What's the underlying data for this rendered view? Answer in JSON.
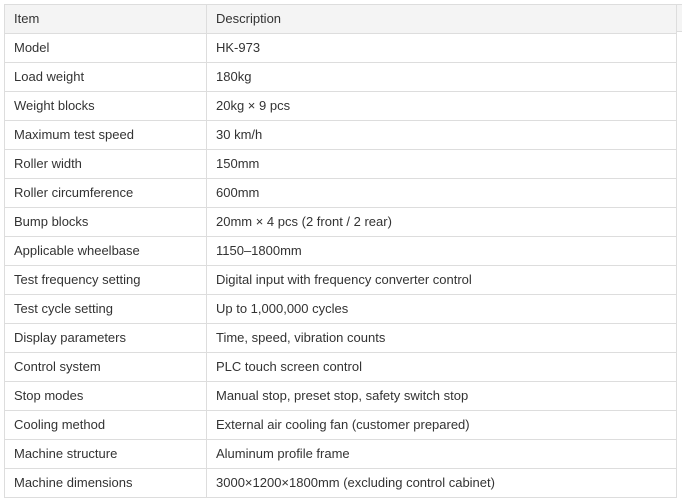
{
  "table": {
    "headers": [
      "Item",
      "Description"
    ],
    "rows": [
      [
        "Model",
        "HK-973"
      ],
      [
        "Load weight",
        "180kg"
      ],
      [
        "Weight blocks",
        "20kg × 9 pcs"
      ],
      [
        "Maximum test speed",
        "30 km/h"
      ],
      [
        "Roller width",
        "150mm"
      ],
      [
        "Roller circumference",
        "600mm"
      ],
      [
        "Bump blocks",
        "20mm × 4 pcs (2 front / 2 rear)"
      ],
      [
        "Applicable wheelbase",
        "1150–1800mm"
      ],
      [
        "Test frequency setting",
        "Digital input with frequency converter control"
      ],
      [
        "Test cycle setting",
        "Up to 1,000,000 cycles"
      ],
      [
        "Display parameters",
        "Time, speed, vibration counts"
      ],
      [
        "Control system",
        "PLC touch screen control"
      ],
      [
        "Stop modes",
        "Manual stop, preset stop, safety switch stop"
      ],
      [
        "Cooling method",
        "External air cooling fan (customer prepared)"
      ],
      [
        "Machine structure",
        "Aluminum profile frame"
      ],
      [
        "Machine dimensions",
        "3000×1200×1800mm (excluding control cabinet)"
      ]
    ]
  }
}
